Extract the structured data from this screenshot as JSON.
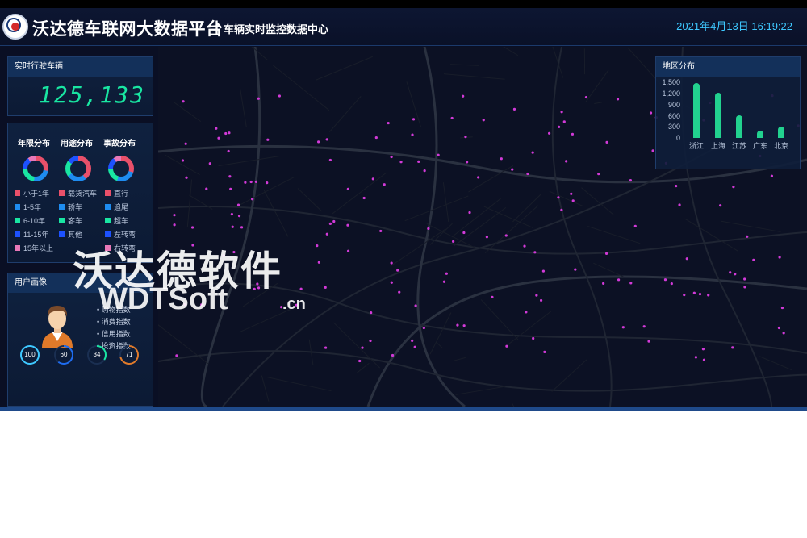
{
  "header": {
    "title": "沃达德车联网大数据平台",
    "separator": "|",
    "subtitle": "车辆实时监控数据中心",
    "datetime": "2021年4月13日  16:19:22"
  },
  "realtime": {
    "label": "实时行驶车辆",
    "count": "125,133"
  },
  "distribution": {
    "headings": [
      "年限分布",
      "用途分布",
      "事故分布"
    ],
    "age_legend": [
      "小于1年",
      "1-5年",
      "6-10年",
      "11-15年",
      "15年以上"
    ],
    "use_legend": [
      "载货汽车",
      "轿车",
      "客车",
      "其他"
    ],
    "accident_legend": [
      "直行",
      "追尾",
      "超车",
      "左转弯",
      "右转弯"
    ],
    "colors": {
      "red": "#e9506a",
      "blue": "#1e8cf0",
      "green": "#19e6a2",
      "navy": "#1d52ff",
      "pink": "#e878b8"
    }
  },
  "user_profile": {
    "label": "用户画像",
    "bullets": [
      "• 购物指数",
      "• 消费指数",
      "• 信用指数",
      "• 投资指数"
    ],
    "gauges": [
      {
        "value": "100",
        "color": "#3ec8ff",
        "fraction": 1.0
      },
      {
        "value": "60",
        "color": "#1e6cf0",
        "fraction": 0.6
      },
      {
        "value": "34",
        "color": "#19e6a2",
        "fraction": 0.34
      },
      {
        "value": "71",
        "color": "#e07a2a",
        "fraction": 0.71
      }
    ]
  },
  "region": {
    "label": "地区分布"
  },
  "chart_data": {
    "type": "bar",
    "title": "地区分布",
    "categories": [
      "浙江",
      "上海",
      "江苏",
      "广东",
      "北京"
    ],
    "values": [
      1450,
      1200,
      600,
      200,
      300
    ],
    "yticks": [
      "1,500",
      "1,200",
      "900",
      "600",
      "300",
      "0"
    ],
    "ylim": [
      0,
      1500
    ],
    "color": "#22d28f"
  },
  "watermark": {
    "line1": "沃达德软件",
    "line2": "WDTSoft",
    "line3": ".cn"
  }
}
